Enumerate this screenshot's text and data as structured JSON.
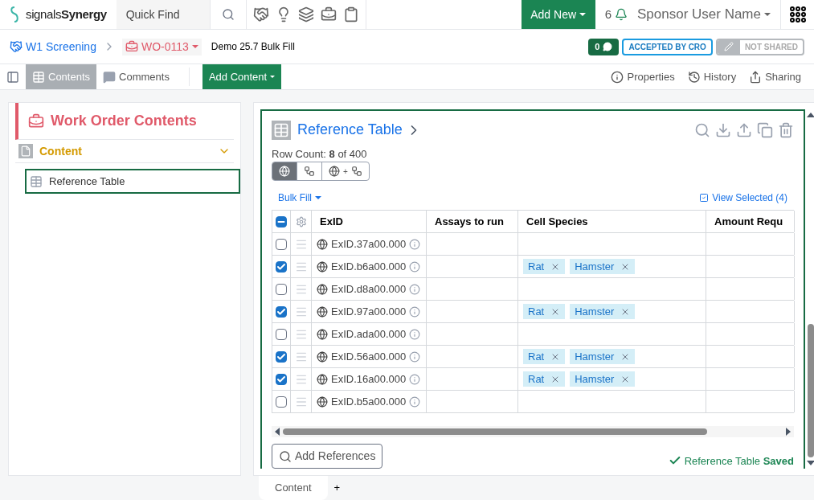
{
  "topbar": {
    "brand_light": "signals",
    "brand_bold": "Synergy",
    "quick_find": {
      "placeholder": "Quick Find"
    },
    "add_new": "Add New",
    "notifications": "6",
    "user": "Sponsor User Name"
  },
  "breadcrumb": {
    "project": "W1 Screening",
    "work_order": "WO-0113",
    "title": "Demo 25.7 Bulk Fill",
    "comments": "0",
    "status": "ACCEPTED BY CRO",
    "sharing": "NOT SHARED"
  },
  "toolbar": {
    "tabs": [
      {
        "label": "Contents",
        "selected": true
      },
      {
        "label": "Comments",
        "selected": false
      }
    ],
    "add_content": "Add Content",
    "actions": [
      "Properties",
      "History",
      "Sharing"
    ]
  },
  "sidebar": {
    "title": "Work Order Contents",
    "section": {
      "label": "Content",
      "expanded": true
    },
    "items": [
      {
        "label": "Reference Table",
        "selected": true
      }
    ]
  },
  "panel": {
    "title": "Reference Table",
    "row_count": "Row Count: **8** of 400",
    "view_modes": [
      {
        "kind": "globe",
        "selected": true
      },
      {
        "kind": "network",
        "selected": false
      },
      {
        "kind": "both",
        "label": "+",
        "selected": false
      }
    ],
    "bulk_fill": "Bulk Fill",
    "view_selected": "View Selected (4)",
    "select_all": {
      "partial": true
    },
    "columns": [
      "ExID",
      "Assays to run",
      "Cell Species",
      "Amount Requ"
    ],
    "rows": [
      {
        "checked": false,
        "exid": "ExID.37a00.000",
        "species": []
      },
      {
        "checked": true,
        "exid": "ExID.b6a00.000",
        "species": [
          "Rat",
          "Hamster"
        ]
      },
      {
        "checked": false,
        "exid": "ExID.d8a00.000",
        "species": []
      },
      {
        "checked": true,
        "exid": "ExID.97a00.000",
        "species": [
          "Rat",
          "Hamster"
        ]
      },
      {
        "checked": false,
        "exid": "ExID.ada00.000",
        "species": []
      },
      {
        "checked": true,
        "exid": "ExID.56a00.000",
        "species": [
          "Rat",
          "Hamster"
        ]
      },
      {
        "checked": true,
        "exid": "ExID.16a00.000",
        "species": [
          "Rat",
          "Hamster"
        ]
      },
      {
        "checked": false,
        "exid": "ExID.b5a00.000",
        "species": []
      }
    ],
    "add_references": "Add References",
    "saved": "Reference Table **Saved**"
  },
  "bottom_tabs": [
    {
      "label": "Content",
      "selected": true
    }
  ],
  "add_tab": "+"
}
